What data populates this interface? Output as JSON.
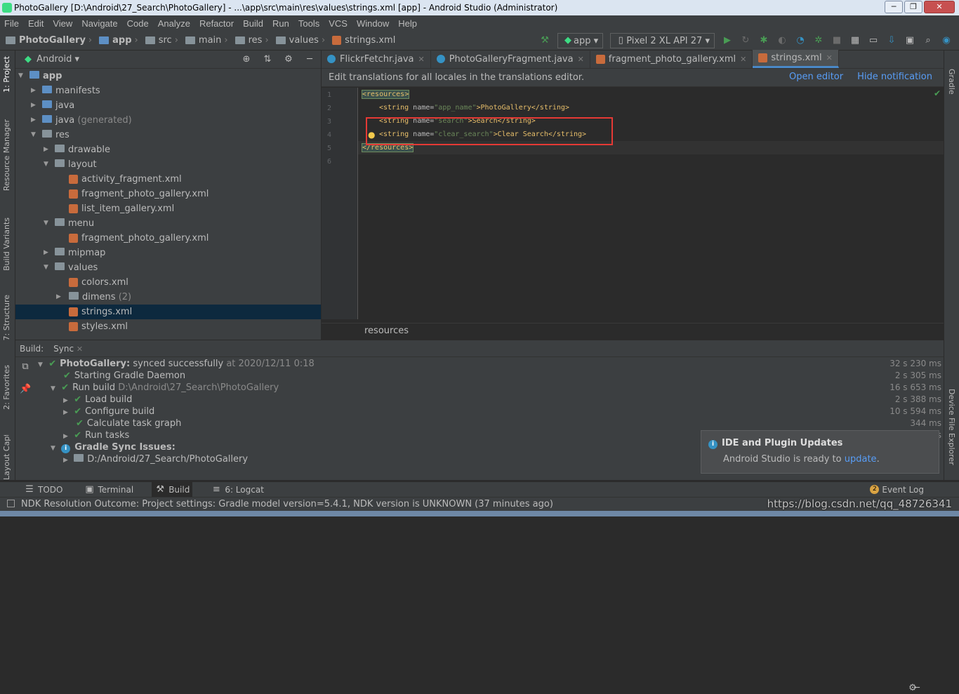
{
  "window": {
    "title": "PhotoGallery [D:\\Android\\27_Search\\PhotoGallery] - ...\\app\\src\\main\\res\\values\\strings.xml [app] - Android Studio (Administrator)"
  },
  "menu": [
    "File",
    "Edit",
    "View",
    "Navigate",
    "Code",
    "Analyze",
    "Refactor",
    "Build",
    "Run",
    "Tools",
    "VCS",
    "Window",
    "Help"
  ],
  "nav": {
    "crumbs": [
      "PhotoGallery",
      "app",
      "src",
      "main",
      "res",
      "values",
      "strings.xml"
    ],
    "run_config": "app",
    "device": "Pixel 2 XL API 27"
  },
  "left_strip": {
    "project": "1: Project",
    "resource_manager": "Resource Manager",
    "build_variants": "Build Variants",
    "structure": "7: Structure",
    "favorites": "2: Favorites",
    "captures": "Layout Captures"
  },
  "right_strip": {
    "gradle": "Gradle",
    "device_file_explorer": "Device File Explorer"
  },
  "project": {
    "view": "Android",
    "tree": {
      "app": "app",
      "manifests": "manifests",
      "java": "java",
      "java_gen": "java",
      "generated": "(generated)",
      "res": "res",
      "drawable": "drawable",
      "layout": "layout",
      "activity_fragment": "activity_fragment.xml",
      "fragment_photo_gallery": "fragment_photo_gallery.xml",
      "list_item_gallery": "list_item_gallery.xml",
      "menu": "menu",
      "menu_fragment_photo_gallery": "fragment_photo_gallery.xml",
      "mipmap": "mipmap",
      "values": "values",
      "colors": "colors.xml",
      "dimens": "dimens",
      "dimens_count": "(2)",
      "strings": "strings.xml",
      "styles": "styles.xml"
    }
  },
  "editor": {
    "tabs": [
      "FlickrFetchr.java",
      "PhotoGalleryFragment.java",
      "fragment_photo_gallery.xml",
      "strings.xml"
    ],
    "notification": "Edit translations for all locales in the translations editor.",
    "open_editor": "Open editor",
    "hide_notification": "Hide notification",
    "line_numbers": [
      "1",
      "2",
      "3",
      "4",
      "5",
      "6"
    ],
    "code": {
      "l1_tag": "<resources>",
      "l2_open": "<string ",
      "l2_attr": "name=",
      "l2_val": "\"app_name\"",
      "l2_text": ">PhotoGallery</string>",
      "l3_open": "<string ",
      "l3_attr": "name=",
      "l3_val": "\"search\"",
      "l3_text": ">Search</string>",
      "l4_open": "<string ",
      "l4_attr": "name=",
      "l4_val": "\"clear_search\"",
      "l4_text": ">Clear Search</string>",
      "l5_tag": "</resources>"
    },
    "breadcrumb": "resources"
  },
  "build": {
    "label": "Build:",
    "tab": "Sync",
    "rows": {
      "r1_title": "PhotoGallery:",
      "r1_status": "synced successfully",
      "r1_at": "at 2020/12/11 0:18",
      "r1_time": "32 s 230 ms",
      "r2": "Starting Gradle Daemon",
      "r2_time": "2 s 305 ms",
      "r3": "Run build",
      "r3_path": "D:\\Android\\27_Search\\PhotoGallery",
      "r3_time": "16 s 653 ms",
      "r4": "Load build",
      "r4_time": "2 s 388 ms",
      "r5": "Configure build",
      "r5_time": "10 s 594 ms",
      "r6": "Calculate task graph",
      "r6_time": "344 ms",
      "r7": "Run tasks",
      "r7_time": "s",
      "r8": "Gradle Sync Issues:",
      "r9": "D:/Android/27_Search/PhotoGallery"
    }
  },
  "toast": {
    "title": "IDE and Plugin Updates",
    "body": "Android Studio is ready to",
    "link": "update",
    "end": "."
  },
  "bottom_tabs": {
    "todo": "TODO",
    "terminal": "Terminal",
    "build": "Build",
    "logcat": "6: Logcat",
    "event_log": "Event Log",
    "event_count": "2"
  },
  "status": {
    "text": "NDK Resolution Outcome: Project settings: Gradle model version=5.4.1, NDK version is UNKNOWN (37 minutes ago)",
    "watermark": "https://blog.csdn.net/qq_48726341"
  },
  "colors": {
    "accent": "#4a88c7",
    "success": "#499c54",
    "highlight_box": "#e53935",
    "link": "#589df6"
  }
}
